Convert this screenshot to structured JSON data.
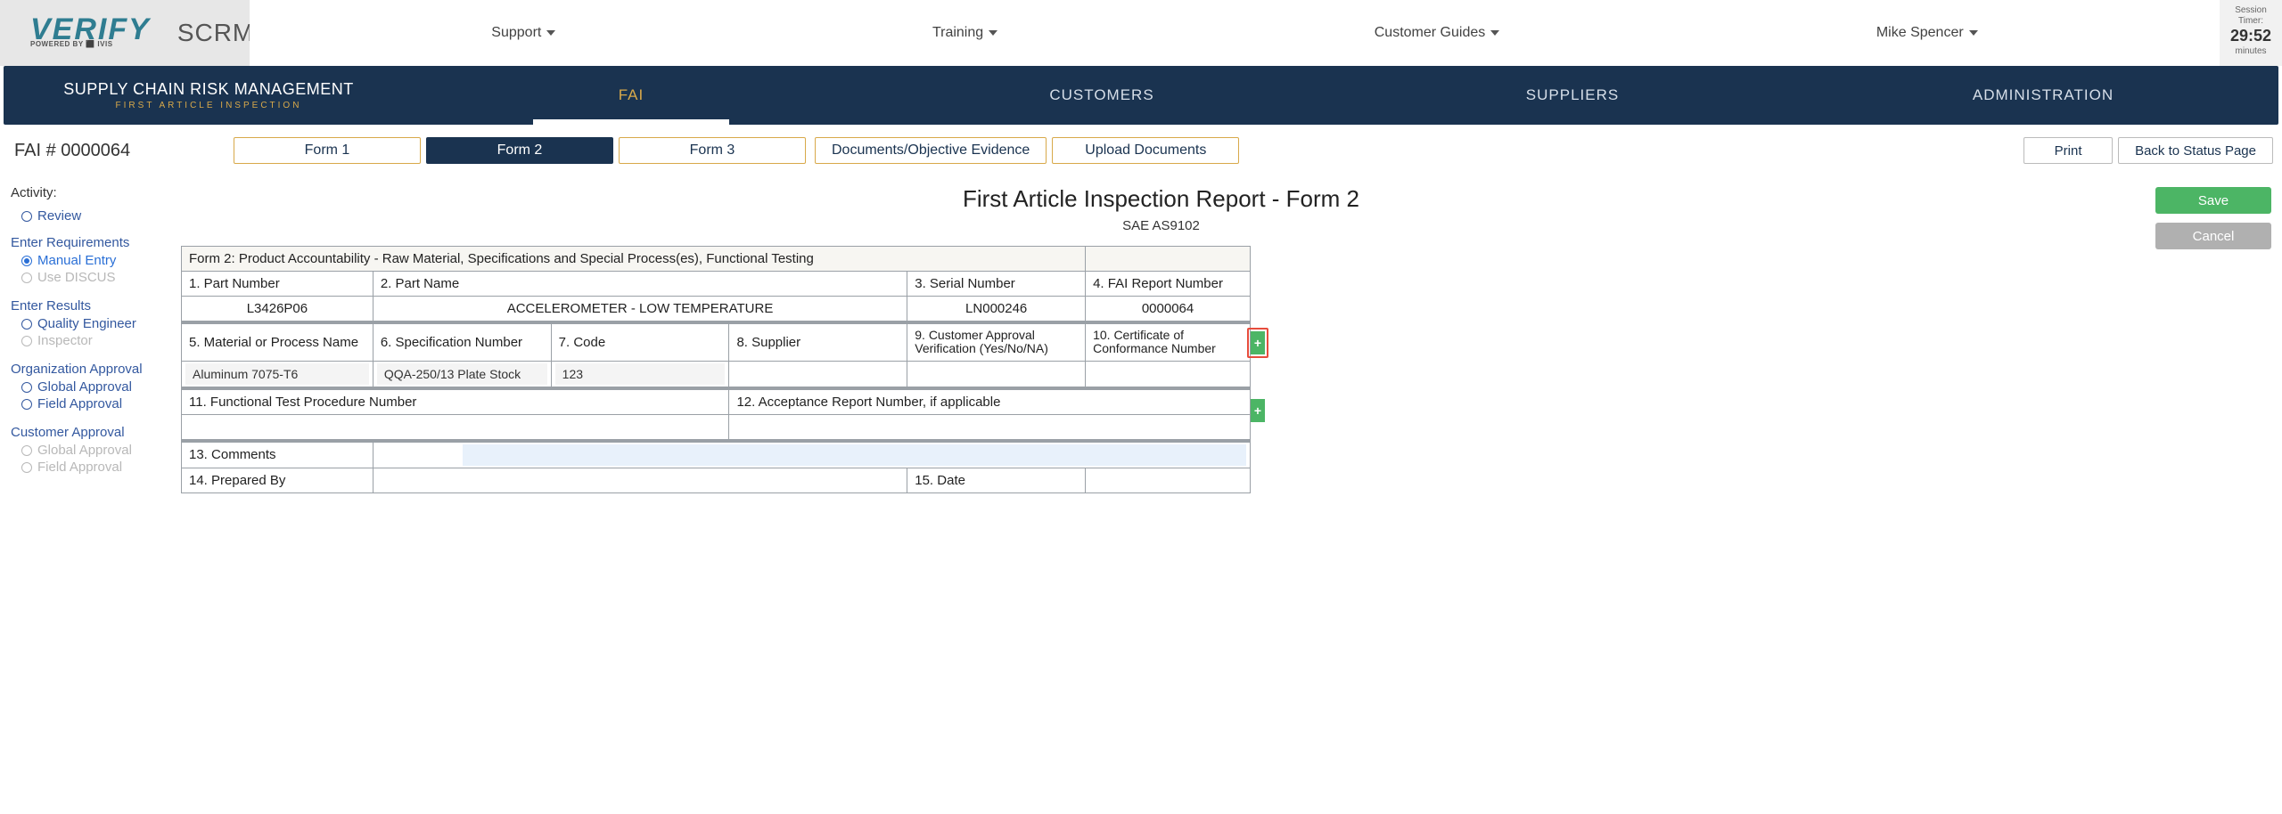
{
  "header": {
    "logo_main": "VERIFY",
    "logo_sub": "POWERED BY ⬛ IVIS",
    "logo_right": "SCRM",
    "menu": [
      "Support",
      "Training",
      "Customer Guides",
      "Mike Spencer"
    ],
    "timer": {
      "label1": "Session",
      "label2": "Timer:",
      "value": "29:52",
      "unit": "minutes"
    }
  },
  "mainnav": {
    "title": "SUPPLY CHAIN RISK MANAGEMENT",
    "subtitle": "FIRST ARTICLE INSPECTION",
    "tabs": [
      "FAI",
      "CUSTOMERS",
      "SUPPLIERS",
      "ADMINISTRATION"
    ],
    "active": 0
  },
  "toolbar": {
    "fai_id": "FAI # 0000064",
    "forms": [
      "Form 1",
      "Form 2",
      "Form 3"
    ],
    "active_form": 1,
    "docs": "Documents/Objective Evidence",
    "upload": "Upload Documents",
    "print": "Print",
    "back": "Back to Status Page"
  },
  "sidebar": {
    "activity": "Activity:",
    "review": "Review",
    "groups": [
      {
        "title": "Enter Requirements",
        "opts": [
          {
            "label": "Manual Entry",
            "selected": true,
            "disabled": false
          },
          {
            "label": "Use DISCUS",
            "selected": false,
            "disabled": true
          }
        ]
      },
      {
        "title": "Enter Results",
        "opts": [
          {
            "label": "Quality Engineer",
            "selected": false,
            "disabled": false
          },
          {
            "label": "Inspector",
            "selected": false,
            "disabled": true
          }
        ]
      },
      {
        "title": "Organization Approval",
        "opts": [
          {
            "label": "Global Approval",
            "selected": false,
            "disabled": false
          },
          {
            "label": "Field Approval",
            "selected": false,
            "disabled": false
          }
        ]
      },
      {
        "title": "Customer Approval",
        "opts": [
          {
            "label": "Global Approval",
            "selected": false,
            "disabled": true
          },
          {
            "label": "Field Approval",
            "selected": false,
            "disabled": true
          }
        ]
      }
    ]
  },
  "form": {
    "title": "First Article Inspection Report - Form 2",
    "sub": "SAE AS9102",
    "section": "Form 2: Product Accountability - Raw Material, Specifications and Special Process(es), Functional Testing",
    "h1": "1. Part Number",
    "h2": "2. Part Name",
    "h3": "3. Serial Number",
    "h4": "4. FAI Report Number",
    "v1": "L3426P06",
    "v2": "ACCELEROMETER - LOW TEMPERATURE",
    "v3": "LN000246",
    "v4": "0000064",
    "h5": "5. Material or Process Name",
    "h6": "6. Specification Number",
    "h7": "7. Code",
    "h8": "8. Supplier",
    "h9": "9. Customer Approval Verification (Yes/No/NA)",
    "h10": "10. Certificate of Conformance Number",
    "r1": {
      "material": "Aluminum 7075-T6",
      "spec": "QQA-250/13 Plate Stock",
      "code": "123",
      "supplier": "",
      "cav": "",
      "coc": ""
    },
    "h11": "11. Functional Test Procedure Number",
    "h12": "12. Acceptance Report Number, if applicable",
    "h13": "13. Comments",
    "h14": "14. Prepared By",
    "h15": "15. Date",
    "comments": "",
    "prepared_by": "",
    "date": ""
  },
  "actions": {
    "save": "Save",
    "cancel": "Cancel"
  }
}
